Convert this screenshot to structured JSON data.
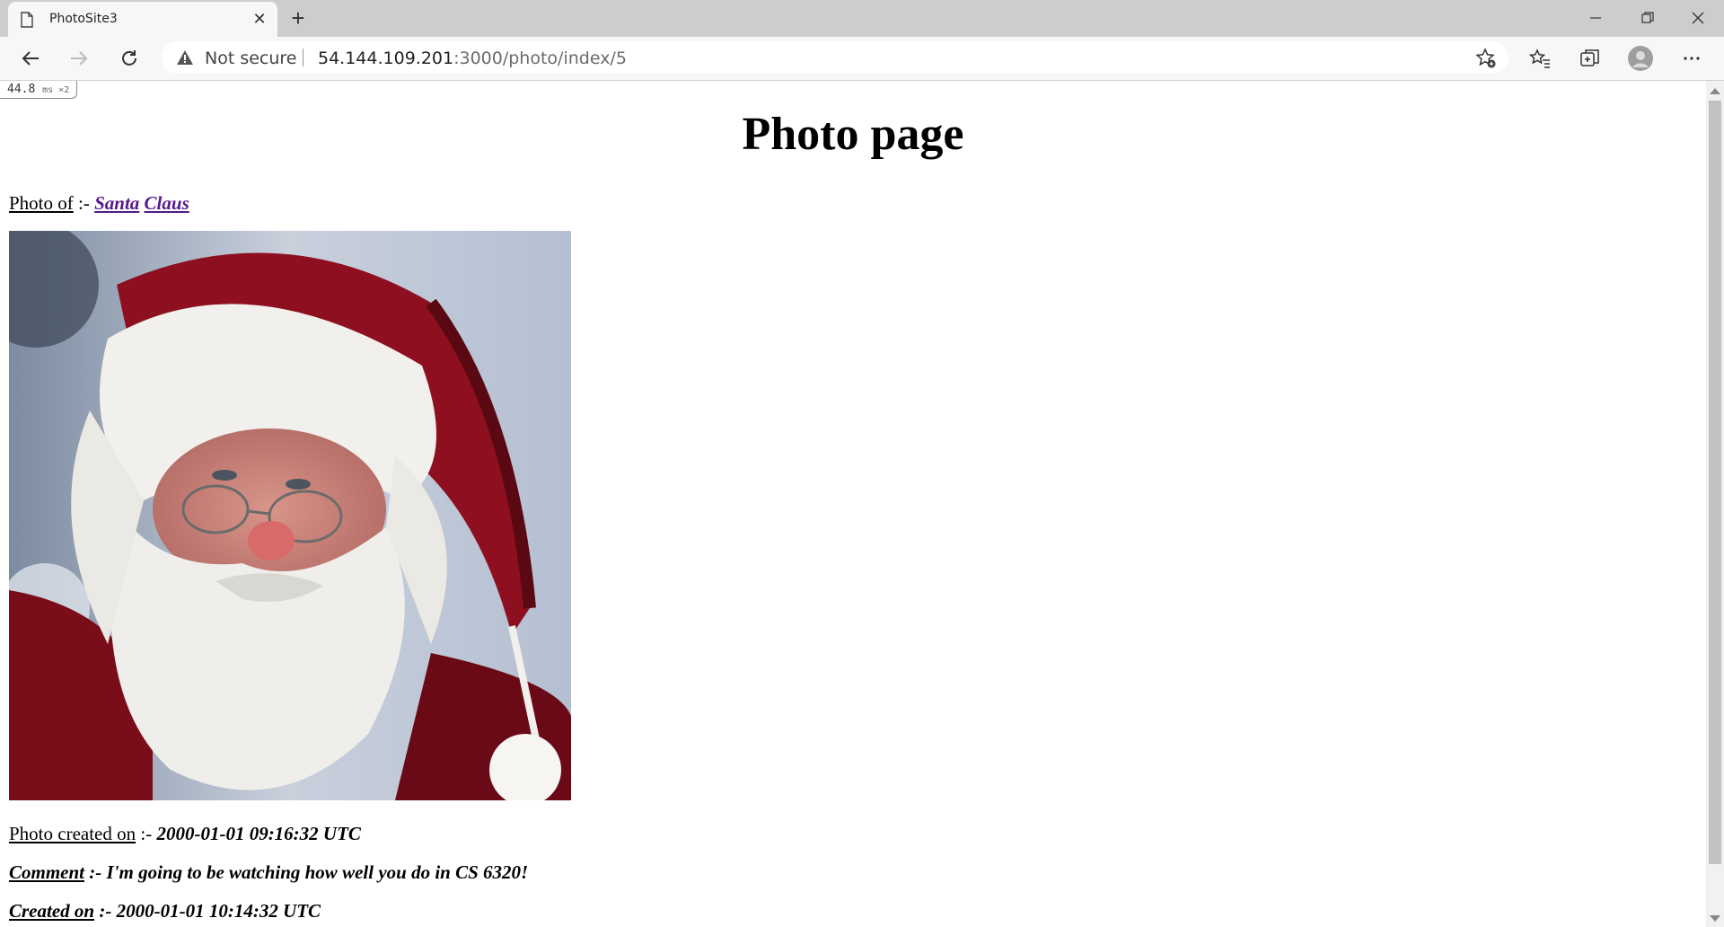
{
  "browser": {
    "tab_title": "PhotoSite3",
    "security_label": "Not secure",
    "url_host": "54.144.109.201",
    "url_rest": ":3000/photo/index/5"
  },
  "page": {
    "perf_time": "44.8",
    "perf_unit": "ms ×2",
    "title": "Photo page",
    "photo_of_label": "Photo of",
    "separator": ":-",
    "user_first_name": "Santa",
    "user_last_name": "Claus",
    "photo_created_label": "Photo created on",
    "photo_created_value": "2000-01-01 09:16:32 UTC",
    "comment_label": "Comment",
    "comment_text": "I'm going to be watching how well you do in CS 6320!",
    "comment_created_label": "Created on",
    "comment_created_value": "2000-01-01 10:14:32 UTC"
  },
  "colors": {
    "link_visited": "#551a8b",
    "chrome_bg": "#cdcdcd",
    "toolbar_bg": "#f7f7f7"
  }
}
